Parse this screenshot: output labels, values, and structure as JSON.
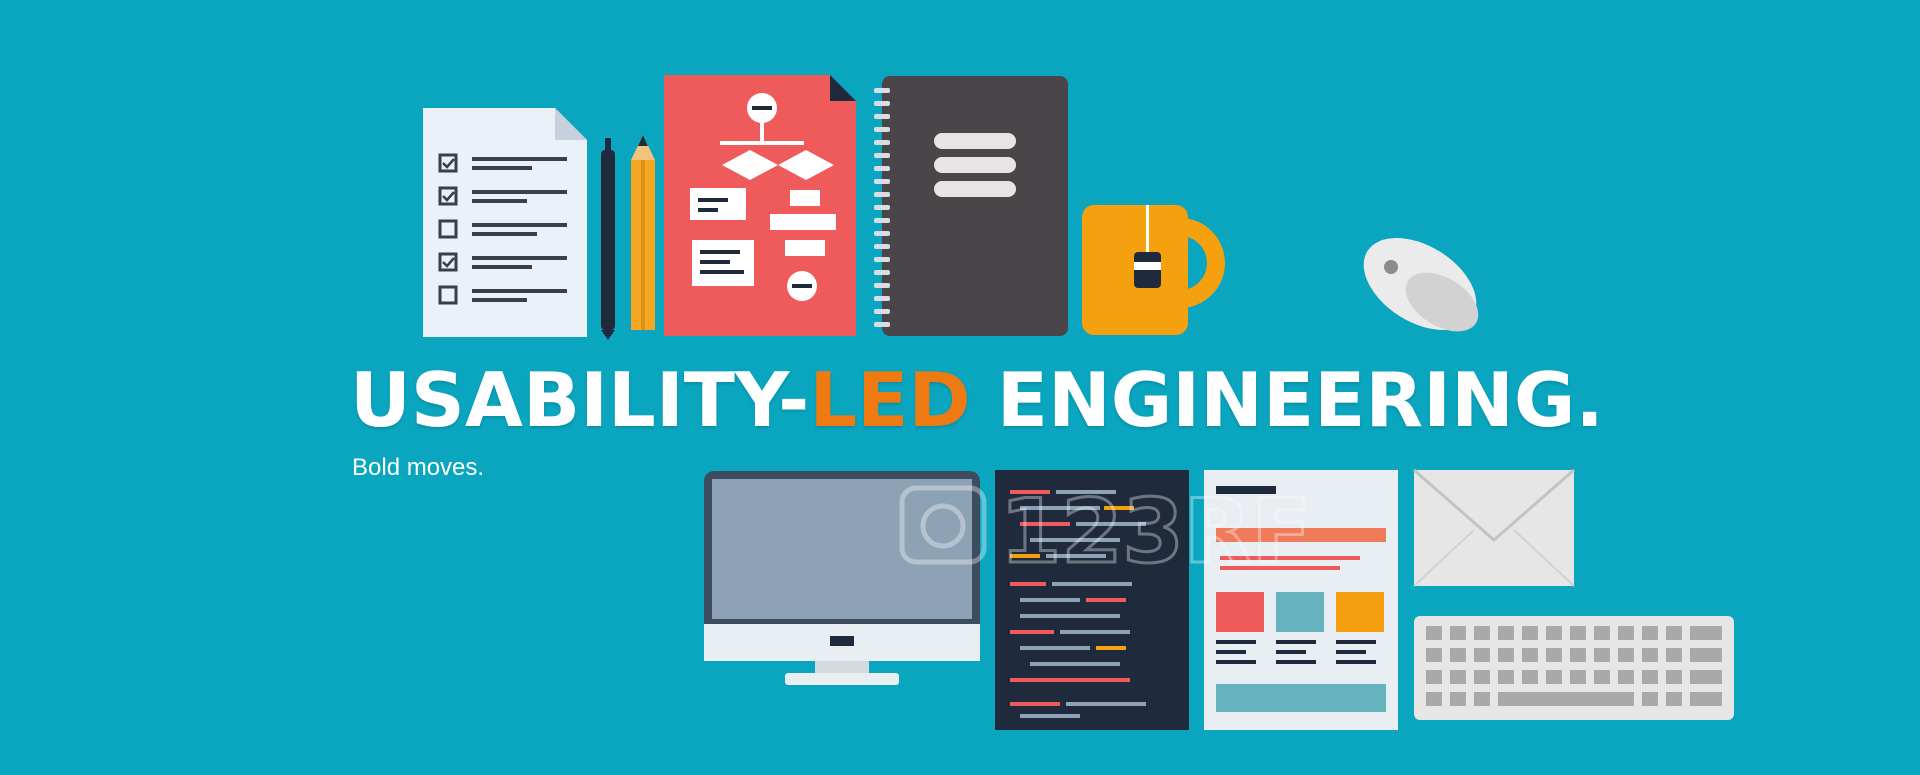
{
  "banner": {
    "headline_part1": "USABILITY-",
    "headline_accent": "LED",
    "headline_part2": " ENGINEERING.",
    "tagline": "Bold moves.",
    "watermark": "123RF"
  },
  "colors": {
    "background": "#0aa6c0",
    "accent": "#f07a12",
    "headline": "#ffffff"
  },
  "icons": [
    "checklist-icon",
    "pen-icon",
    "pencil-icon",
    "flowchart-icon",
    "notebook-icon",
    "mug-icon",
    "mouse-icon",
    "monitor-icon",
    "code-editor-icon",
    "web-layout-icon",
    "envelope-icon",
    "keyboard-icon"
  ]
}
